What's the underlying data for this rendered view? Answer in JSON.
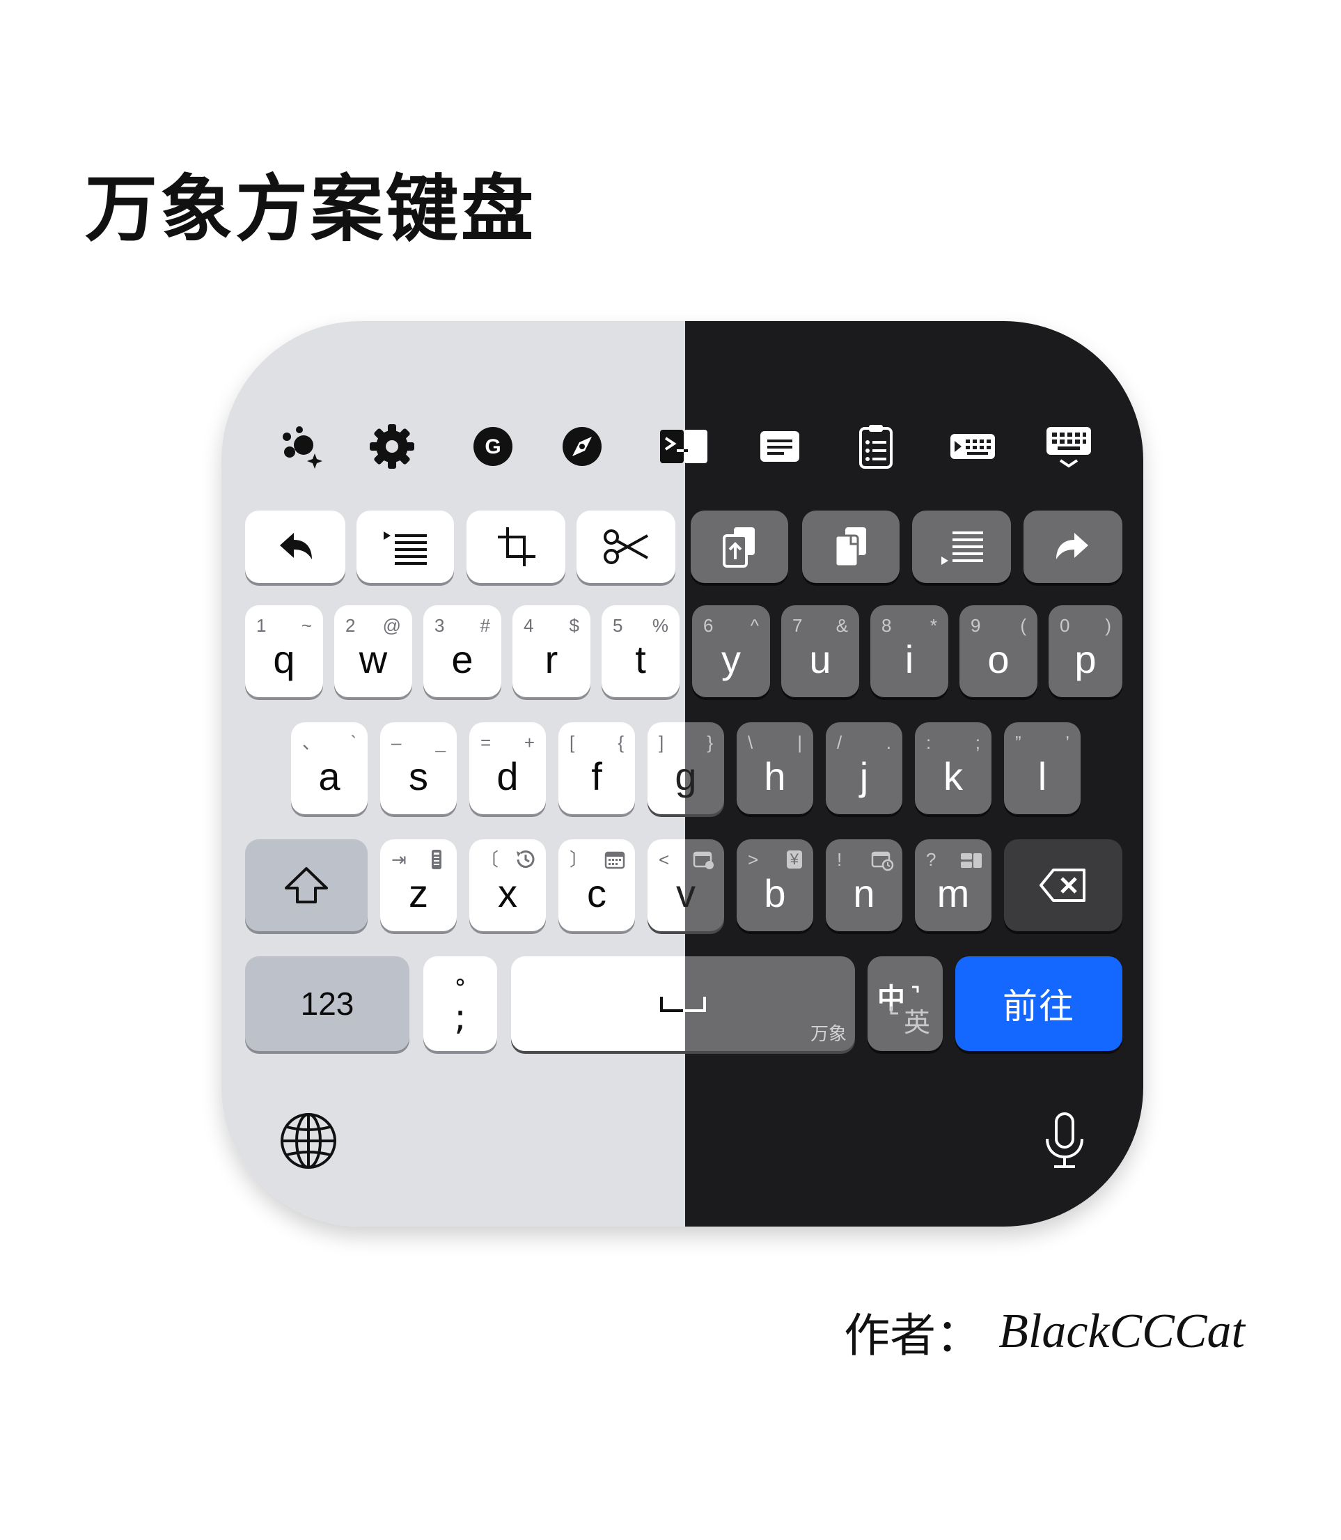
{
  "page": {
    "title": "万象方案键盘",
    "author_label": "作者：",
    "author_name": "BlackCCCat"
  },
  "colors": {
    "light_bg": "#dfe0e4",
    "dark_bg": "#1b1b1d",
    "light_key": "#ffffff",
    "dark_key": "#6c6c6e",
    "accent": "#1467ff"
  },
  "toolbar": [
    "assistant-sparkle-icon",
    "gear-icon",
    "grammar-g-icon",
    "compass-icon",
    "terminal-icon",
    "text-document-icon",
    "clipboard-list-icon",
    "keyboard-right-icon",
    "keyboard-dismiss-icon"
  ],
  "function_row": [
    "undo-icon",
    "indent-list-icon",
    "crop-icon",
    "scissors-icon",
    "paste-icon",
    "copy-icon",
    "select-all-icon",
    "redo-icon"
  ],
  "rows": {
    "row1": [
      {
        "key": "q",
        "hl": "1",
        "hr": "~"
      },
      {
        "key": "w",
        "hl": "2",
        "hr": "@"
      },
      {
        "key": "e",
        "hl": "3",
        "hr": "#"
      },
      {
        "key": "r",
        "hl": "4",
        "hr": "$"
      },
      {
        "key": "t",
        "hl": "5",
        "hr": "%"
      },
      {
        "key": "y",
        "hl": "6",
        "hr": "^"
      },
      {
        "key": "u",
        "hl": "7",
        "hr": "&"
      },
      {
        "key": "i",
        "hl": "8",
        "hr": "*"
      },
      {
        "key": "o",
        "hl": "9",
        "hr": "("
      },
      {
        "key": "p",
        "hl": "0",
        "hr": ")"
      }
    ],
    "row2": [
      {
        "key": "a",
        "hl": "、",
        "hr": "`"
      },
      {
        "key": "s",
        "hl": "–",
        "hr": "_"
      },
      {
        "key": "d",
        "hl": "=",
        "hr": "+"
      },
      {
        "key": "f",
        "hl": "[",
        "hr": "{"
      },
      {
        "key": "g",
        "hl": "]",
        "hr": "}"
      },
      {
        "key": "h",
        "hl": "\\",
        "hr": "|"
      },
      {
        "key": "j",
        "hl": "/",
        "hr": "."
      },
      {
        "key": "k",
        "hl": ":",
        "hr": ";"
      },
      {
        "key": "l",
        "hl": "”",
        "hr": "’"
      }
    ],
    "row3": [
      {
        "key": "z",
        "hl": "⇥",
        "hr_icon": "remote-icon"
      },
      {
        "key": "x",
        "hl": "〔",
        "hr_icon": "history-icon"
      },
      {
        "key": "c",
        "hl": "〕",
        "hr_icon": "calendar-icon"
      },
      {
        "key": "v",
        "hl": "<",
        "hr_icon": "calendar-check-icon"
      },
      {
        "key": "b",
        "hl": ">",
        "hr": "¥"
      },
      {
        "key": "n",
        "hl": "!",
        "hr_icon": "calendar-clock-icon"
      },
      {
        "key": "m",
        "hl": "?",
        "hr_icon": "layout-icon"
      }
    ]
  },
  "bottom_row": {
    "numbers": "123",
    "punct_top": "°",
    "punct_main": ";",
    "space_brand": "万象",
    "lang_top": "中",
    "lang_bottom": "英",
    "go": "前往"
  },
  "bottom_icons": [
    "globe-icon",
    "microphone-icon"
  ]
}
